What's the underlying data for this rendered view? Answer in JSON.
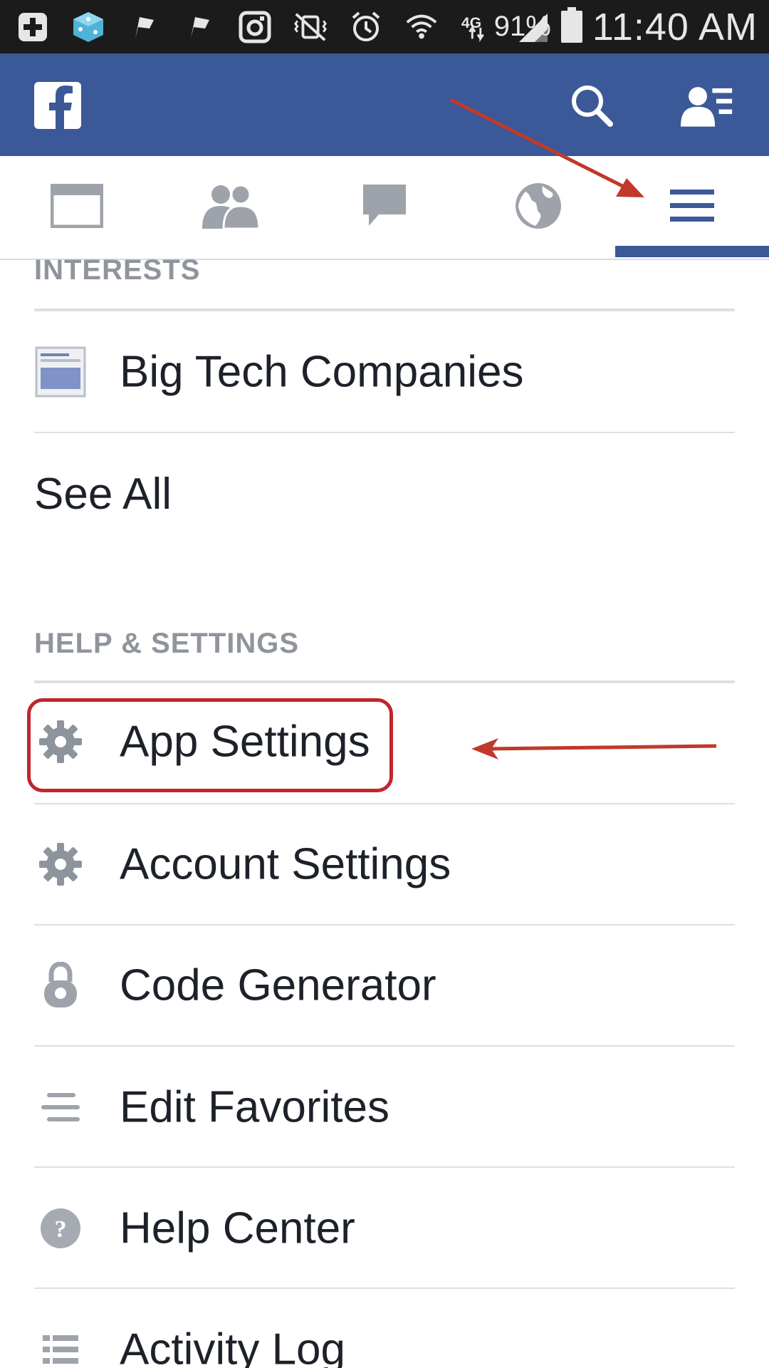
{
  "status_bar": {
    "battery": "91%",
    "time": "11:40 AM",
    "network": "4G",
    "icons": [
      "add-icon",
      "dice-app-icon",
      "flag-icon",
      "flag-icon",
      "instagram-icon",
      "vibrate-mute-icon",
      "alarm-icon",
      "wifi-icon",
      "lte-icon",
      "signal-icon",
      "battery-icon"
    ]
  },
  "header": {
    "logo_letter": "f",
    "icons": [
      "facebook-logo",
      "search-icon",
      "friend-requests-icon"
    ]
  },
  "tabs": [
    {
      "icon": "news-feed-icon",
      "active": false
    },
    {
      "icon": "friends-icon",
      "active": false
    },
    {
      "icon": "messages-icon",
      "active": false
    },
    {
      "icon": "notifications-globe-icon",
      "active": false
    },
    {
      "icon": "menu-icon",
      "active": true
    }
  ],
  "menu": {
    "interests_header": "INTERESTS",
    "interests_items": [
      {
        "label": "Big Tech Companies",
        "icon": "feed-list-icon"
      }
    ],
    "see_all": "See All",
    "help_header": "HELP & SETTINGS",
    "help_items": [
      {
        "label": "App Settings",
        "icon": "gear-icon"
      },
      {
        "label": "Account Settings",
        "icon": "gear-icon"
      },
      {
        "label": "Code Generator",
        "icon": "lock-icon"
      },
      {
        "label": "Edit Favorites",
        "icon": "lines-icon"
      },
      {
        "label": "Help Center",
        "icon": "question-icon"
      },
      {
        "label": "Activity Log",
        "icon": "list-icon"
      }
    ]
  },
  "colors": {
    "brand_blue": "#3b5998",
    "annotation_red": "#c0262d",
    "section_gray": "#90949c",
    "icon_gray": "#9ea3ab"
  }
}
